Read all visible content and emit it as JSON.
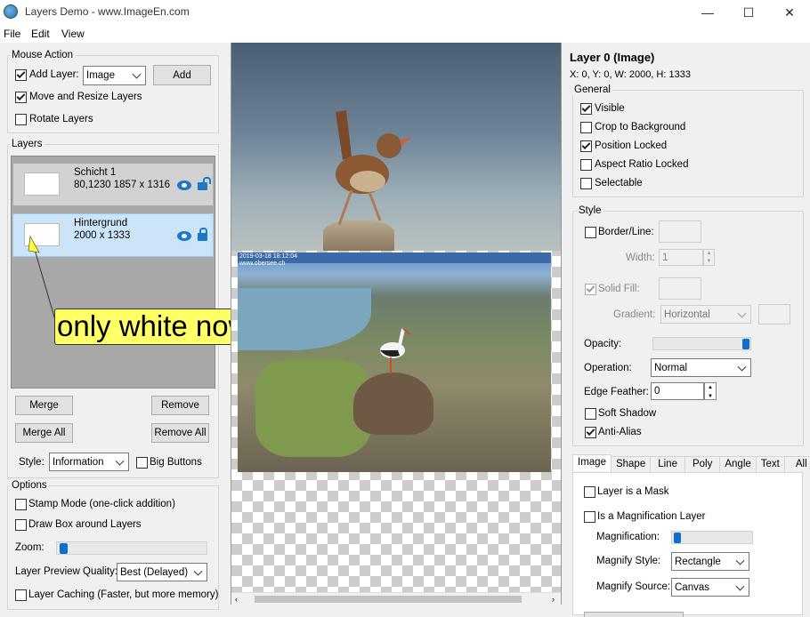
{
  "window": {
    "title": "Layers Demo - www.ImageEn.com",
    "minimize": "—",
    "maximize": "☐",
    "close": "✕"
  },
  "menu": [
    "File",
    "Edit",
    "View"
  ],
  "mouse_action": {
    "group": "Mouse Action",
    "add_layer": "Add Layer:",
    "add_layer_type": "Image",
    "add_button": "Add",
    "move_resize": "Move and Resize Layers",
    "rotate": "Rotate Layers"
  },
  "layers": {
    "group": "Layers",
    "items": [
      {
        "name": "Schicht 1",
        "info": "80,1230  1857 x 1316"
      },
      {
        "name": "Hintergrund",
        "info": "2000 x 1333"
      }
    ],
    "annotation": "only white now",
    "merge": "Merge",
    "remove": "Remove",
    "merge_all": "Merge All",
    "remove_all": "Remove All",
    "style_label": "Style:",
    "style_value": "Information",
    "big_buttons": "Big Buttons"
  },
  "options": {
    "group": "Options",
    "stamp": "Stamp Mode (one-click addition)",
    "draw_box": "Draw Box around Layers",
    "zoom": "Zoom:",
    "zoom_level": 0.05,
    "quality_label": "Layer Preview Quality:",
    "quality_value": "Best (Delayed)",
    "caching": "Layer Caching (Faster, but more memory)"
  },
  "canvas": {
    "timestamp": "2019-03-18 18:12:04",
    "website": "www.obersee.ch"
  },
  "props": {
    "title": "Layer 0 (Image)",
    "coords": "X: 0, Y: 0, W: 2000, H: 1333",
    "general": {
      "group": "General",
      "visible": "Visible",
      "crop": "Crop to Background",
      "pos_locked": "Position Locked",
      "aspect": "Aspect Ratio Locked",
      "selectable": "Selectable"
    },
    "style": {
      "group": "Style",
      "border": "Border/Line:",
      "width": "Width:",
      "width_value": "1",
      "solid_fill": "Solid Fill:",
      "gradient": "Gradient:",
      "gradient_value": "Horizontal",
      "opacity": "Opacity:",
      "opacity_level": 1.0,
      "operation": "Operation:",
      "operation_value": "Normal",
      "edge_feather": "Edge Feather:",
      "edge_value": "0",
      "soft_shadow": "Soft Shadow",
      "anti_alias": "Anti-Alias"
    },
    "tabs": [
      "Image",
      "Shape",
      "Line",
      "Poly",
      "Angle",
      "Text",
      "All"
    ],
    "image_tab": {
      "mask": "Layer is a Mask",
      "magnification_layer": "Is a Magnification Layer",
      "magnification": "Magnification:",
      "magnification_level": 0.05,
      "magnify_style": "Magnify Style:",
      "magnify_style_value": "Rectangle",
      "magnify_source": "Magnify Source:",
      "magnify_source_value": "Canvas"
    }
  },
  "colors": {
    "accent": "#0a6fd1",
    "selected_layer": "#cce4f7",
    "annotation_bg": "#ffff66"
  }
}
